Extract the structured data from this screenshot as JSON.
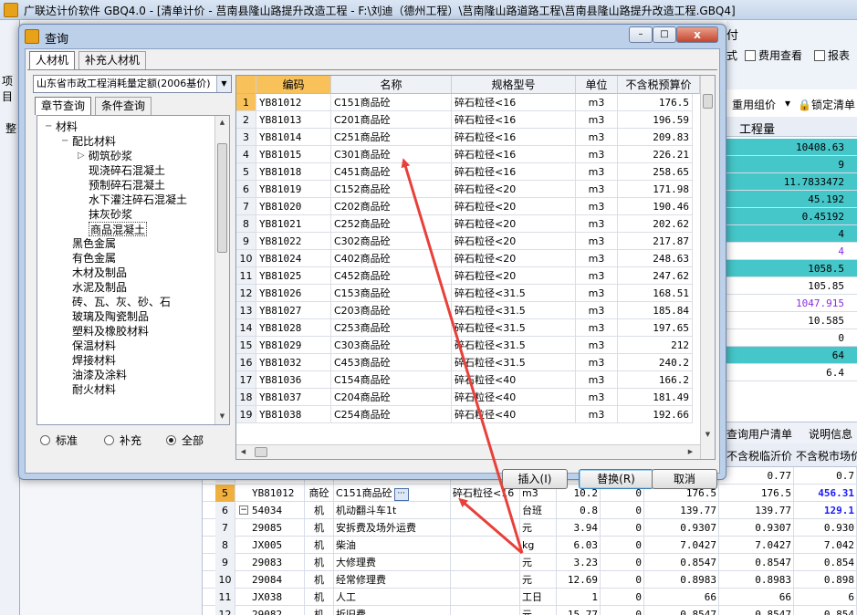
{
  "app": {
    "title": "广联达计价软件 GBQ4.0 - [清单计价 - 莒南县隆山路提升改造工程 - F:\\刘迪（德州工程）\\莒南隆山路道路工程\\莒南县隆山路提升改造工程.GBQ4]",
    "menu_fu": "付",
    "tool_cost_view": "费用查看",
    "tool_report": "报表",
    "tool_style": "式",
    "left_label_xiangmu": "项目",
    "left_label_zheng": "整",
    "tool_reuse_price": "重用组价",
    "tool_lock_list": "锁定清单",
    "col_quantity": "工程量",
    "tab_query_user_list": "查询用户清单",
    "tab_description": "说明信息",
    "col_tax_excl_local": "不含税临沂价",
    "col_tax_excl_market": "不含税市场价"
  },
  "upper_values": [
    {
      "v": "10408.63",
      "style": "cyan"
    },
    {
      "v": "9",
      "style": "cyan"
    },
    {
      "v": "11.7833472",
      "style": "cyan"
    },
    {
      "v": "45.192",
      "style": "cyan"
    },
    {
      "v": "0.45192",
      "style": "cyan"
    },
    {
      "v": "4",
      "style": "cyan"
    },
    {
      "v": "4",
      "style": "purple"
    },
    {
      "v": "1058.5",
      "style": "cyan"
    },
    {
      "v": "105.85",
      "style": ""
    },
    {
      "v": "1047.915",
      "style": "purple"
    },
    {
      "v": "10.585",
      "style": ""
    },
    {
      "v": "0",
      "style": ""
    },
    {
      "v": "64",
      "style": "cyan"
    },
    {
      "v": "6.4",
      "style": ""
    }
  ],
  "lower_rows": [
    {
      "rn": "",
      "code": "",
      "typ": "",
      "nm": "",
      "sp": "",
      "un": "",
      "q1": "",
      "q2": "",
      "p1": "",
      "p2": "0.77",
      "p3": "0.7"
    },
    {
      "rn": "5",
      "code": "YB81012",
      "typ": "商砼",
      "nm": "C151商品砼",
      "sp": "碎石粒径<16",
      "un": "m3",
      "q1": "10.2",
      "q2": "0",
      "p1": "176.5",
      "p2": "176.5",
      "p3": "456.31",
      "sel": true,
      "blue": true
    },
    {
      "rn": "6",
      "code": "54034",
      "typ": "机",
      "nm": "机动翻斗车1t",
      "sp": "",
      "un": "台班",
      "q1": "0.8",
      "q2": "0",
      "p1": "139.77",
      "p2": "139.77",
      "p3": "129.1",
      "tree": true,
      "blue": true
    },
    {
      "rn": "7",
      "code": "29085",
      "typ": "机",
      "nm": "安拆费及场外运费",
      "sp": "",
      "un": "元",
      "q1": "3.94",
      "q2": "0",
      "p1": "0.9307",
      "p2": "0.9307",
      "p3": "0.930"
    },
    {
      "rn": "8",
      "code": "JX005",
      "typ": "机",
      "nm": "柴油",
      "sp": "",
      "un": "kg",
      "q1": "6.03",
      "q2": "0",
      "p1": "7.0427",
      "p2": "7.0427",
      "p3": "7.042"
    },
    {
      "rn": "9",
      "code": "29083",
      "typ": "机",
      "nm": "大修理费",
      "sp": "",
      "un": "元",
      "q1": "3.23",
      "q2": "0",
      "p1": "0.8547",
      "p2": "0.8547",
      "p3": "0.854"
    },
    {
      "rn": "10",
      "code": "29084",
      "typ": "机",
      "nm": "经常修理费",
      "sp": "",
      "un": "元",
      "q1": "12.69",
      "q2": "0",
      "p1": "0.8983",
      "p2": "0.8983",
      "p3": "0.898"
    },
    {
      "rn": "11",
      "code": "JX038",
      "typ": "机",
      "nm": "人工",
      "sp": "",
      "un": "工日",
      "q1": "1",
      "q2": "0",
      "p1": "66",
      "p2": "66",
      "p3": "6"
    },
    {
      "rn": "12",
      "code": "29082",
      "typ": "机",
      "nm": "折旧费",
      "sp": "",
      "un": "元",
      "q1": "15.77",
      "q2": "0",
      "p1": "0.8547",
      "p2": "0.8547",
      "p3": "0.854"
    }
  ],
  "dialog": {
    "title": "查询",
    "btn_close": "x",
    "btn_min": "–",
    "btn_max": "□",
    "tab_rencaiji": "人材机",
    "tab_buchong": "补充人材机",
    "quota_select": "山东省市政工程消耗量定额(2006基价)",
    "tab_zhangjie": "章节查询",
    "tab_tiaojian": "条件查询",
    "tree": [
      {
        "label": "材料",
        "level": 0,
        "expand": "−"
      },
      {
        "label": "配比材料",
        "level": 1,
        "expand": "−"
      },
      {
        "label": "砌筑砂浆",
        "level": 2,
        "expand": "▷"
      },
      {
        "label": "现浇碎石混凝土",
        "level": 2
      },
      {
        "label": "预制碎石混凝土",
        "level": 2
      },
      {
        "label": "水下灌注碎石混凝土",
        "level": 2
      },
      {
        "label": "抹灰砂浆",
        "level": 2
      },
      {
        "label": "商品混凝土",
        "level": 2,
        "sel": true
      },
      {
        "label": "黑色金属",
        "level": 1
      },
      {
        "label": "有色金属",
        "level": 1
      },
      {
        "label": "木材及制品",
        "level": 1
      },
      {
        "label": "水泥及制品",
        "level": 1
      },
      {
        "label": "砖、瓦、灰、砂、石",
        "level": 1
      },
      {
        "label": "玻璃及陶瓷制品",
        "level": 1
      },
      {
        "label": "塑料及橡胶材料",
        "level": 1
      },
      {
        "label": "保温材料",
        "level": 1
      },
      {
        "label": "焊接材料",
        "level": 1
      },
      {
        "label": "油漆及涂料",
        "level": 1
      },
      {
        "label": "耐火材料",
        "level": 1
      }
    ],
    "radio_standard": "标准",
    "radio_supplement": "补充",
    "radio_all": "全部",
    "grid_headers": {
      "code": "编码",
      "name": "名称",
      "spec": "规格型号",
      "unit": "单位",
      "price": "不含税预算价"
    },
    "grid_rows": [
      {
        "rn": "1",
        "code": "YB81012",
        "nm": "C151商品砼",
        "sp": "碎石粒径<16",
        "un": "m3",
        "pr": "176.5",
        "sel": true
      },
      {
        "rn": "2",
        "code": "YB81013",
        "nm": "C201商品砼",
        "sp": "碎石粒径<16",
        "un": "m3",
        "pr": "196.59"
      },
      {
        "rn": "3",
        "code": "YB81014",
        "nm": "C251商品砼",
        "sp": "碎石粒径<16",
        "un": "m3",
        "pr": "209.83"
      },
      {
        "rn": "4",
        "code": "YB81015",
        "nm": "C301商品砼",
        "sp": "碎石粒径<16",
        "un": "m3",
        "pr": "226.21"
      },
      {
        "rn": "5",
        "code": "YB81018",
        "nm": "C451商品砼",
        "sp": "碎石粒径<16",
        "un": "m3",
        "pr": "258.65"
      },
      {
        "rn": "6",
        "code": "YB81019",
        "nm": "C152商品砼",
        "sp": "碎石粒径<20",
        "un": "m3",
        "pr": "171.98"
      },
      {
        "rn": "7",
        "code": "YB81020",
        "nm": "C202商品砼",
        "sp": "碎石粒径<20",
        "un": "m3",
        "pr": "190.46"
      },
      {
        "rn": "8",
        "code": "YB81021",
        "nm": "C252商品砼",
        "sp": "碎石粒径<20",
        "un": "m3",
        "pr": "202.62"
      },
      {
        "rn": "9",
        "code": "YB81022",
        "nm": "C302商品砼",
        "sp": "碎石粒径<20",
        "un": "m3",
        "pr": "217.87"
      },
      {
        "rn": "10",
        "code": "YB81024",
        "nm": "C402商品砼",
        "sp": "碎石粒径<20",
        "un": "m3",
        "pr": "248.63"
      },
      {
        "rn": "11",
        "code": "YB81025",
        "nm": "C452商品砼",
        "sp": "碎石粒径<20",
        "un": "m3",
        "pr": "247.62"
      },
      {
        "rn": "12",
        "code": "YB81026",
        "nm": "C153商品砼",
        "sp": "碎石粒径<31.5",
        "un": "m3",
        "pr": "168.51"
      },
      {
        "rn": "13",
        "code": "YB81027",
        "nm": "C203商品砼",
        "sp": "碎石粒径<31.5",
        "un": "m3",
        "pr": "185.84"
      },
      {
        "rn": "14",
        "code": "YB81028",
        "nm": "C253商品砼",
        "sp": "碎石粒径<31.5",
        "un": "m3",
        "pr": "197.65"
      },
      {
        "rn": "15",
        "code": "YB81029",
        "nm": "C303商品砼",
        "sp": "碎石粒径<31.5",
        "un": "m3",
        "pr": "212"
      },
      {
        "rn": "16",
        "code": "YB81032",
        "nm": "C453商品砼",
        "sp": "碎石粒径<31.5",
        "un": "m3",
        "pr": "240.2"
      },
      {
        "rn": "17",
        "code": "YB81036",
        "nm": "C154商品砼",
        "sp": "碎石粒径<40",
        "un": "m3",
        "pr": "166.2"
      },
      {
        "rn": "18",
        "code": "YB81037",
        "nm": "C204商品砼",
        "sp": "碎石粒径<40",
        "un": "m3",
        "pr": "181.49"
      },
      {
        "rn": "19",
        "code": "YB81038",
        "nm": "C254商品砼",
        "sp": "碎石粒径<40",
        "un": "m3",
        "pr": "192.66"
      }
    ],
    "btn_insert": "插入(I)",
    "btn_replace": "替换(R)",
    "btn_cancel": "取消"
  },
  "colors": {
    "arrow": "#e8403a",
    "cyan": "#45c6c9",
    "selected": "#f9c15a"
  }
}
